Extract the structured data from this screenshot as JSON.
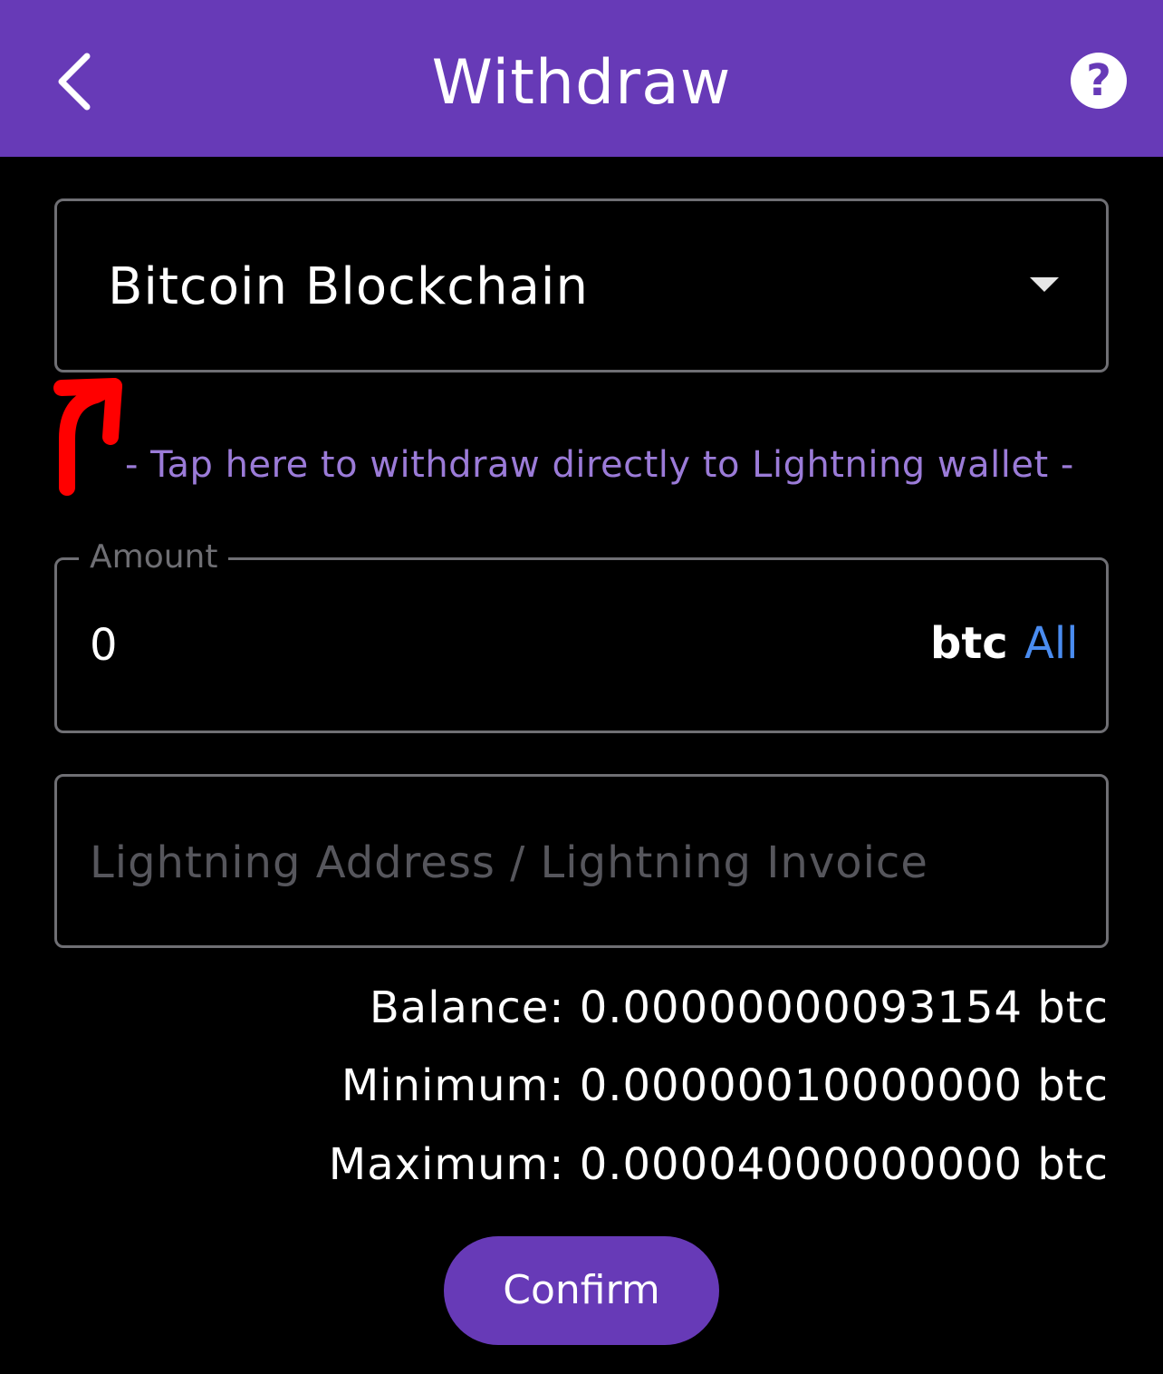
{
  "header": {
    "title": "Withdraw",
    "back_icon": "chevron-left-icon",
    "help_icon": "question-circle-icon",
    "help_glyph": "?",
    "background": "#673ab7"
  },
  "network_select": {
    "value": "Bitcoin Blockchain",
    "dropdown_icon": "caret-down-icon"
  },
  "annotation": {
    "icon": "red-arrow-icon",
    "color": "#ff0000"
  },
  "lightning_link": {
    "text": "- Tap here to withdraw directly to Lightning wallet -",
    "color": "#9b7bd8"
  },
  "amount": {
    "label": "Amount",
    "value": "0",
    "unit": "btc",
    "all_label": "All",
    "all_color": "#4a8cf0"
  },
  "address": {
    "placeholder": "Lightning Address / Lightning Invoice"
  },
  "limits": {
    "balance": "Balance: 0.00000000093154 btc",
    "minimum": "Minimum: 0.00000010000000 btc",
    "maximum": "Maximum: 0.00004000000000 btc"
  },
  "confirm": {
    "label": "Confirm"
  }
}
